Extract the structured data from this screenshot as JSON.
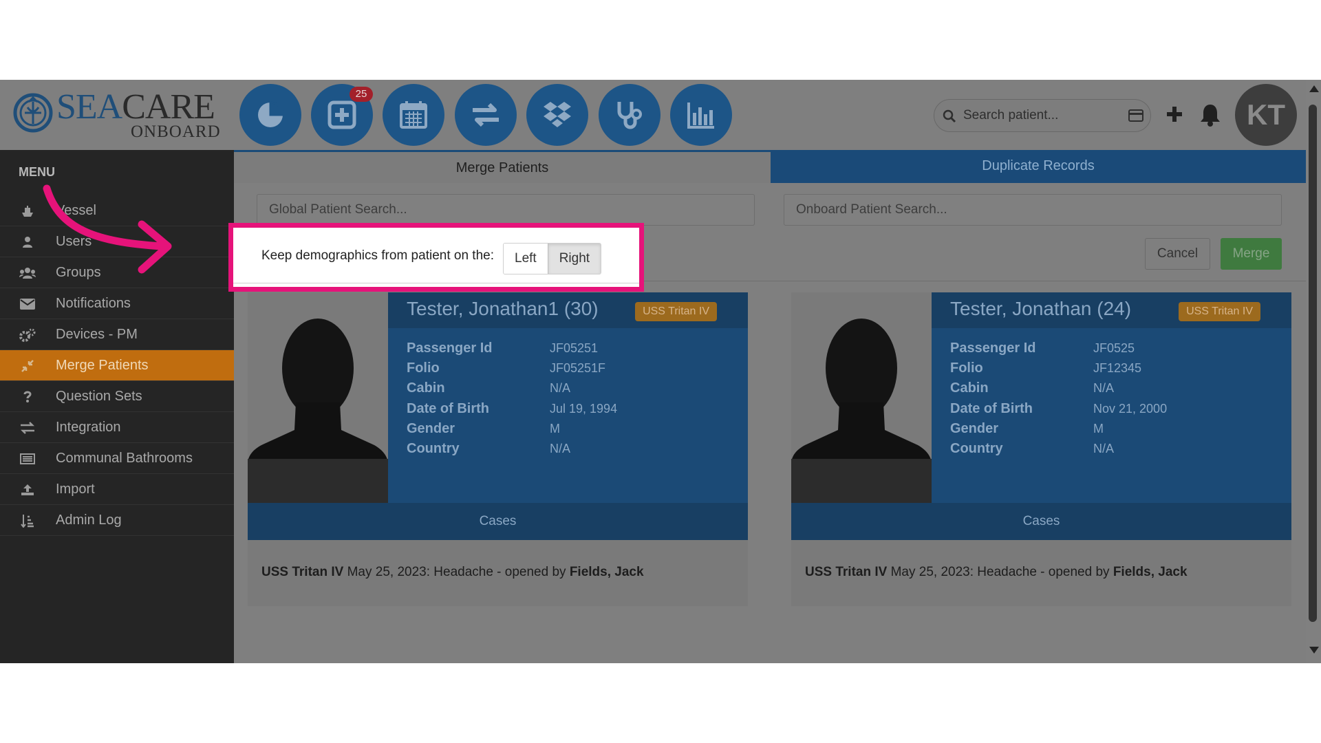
{
  "logo": {
    "word_sea": "SEA",
    "word_care": "CARE",
    "sub": "ONBOARD"
  },
  "nav": [
    {
      "name": "dashboard",
      "icon": "pie-chart-icon"
    },
    {
      "name": "new-case",
      "icon": "plus-square-icon",
      "badge": "25"
    },
    {
      "name": "calendar",
      "icon": "calendar-icon"
    },
    {
      "name": "transfers",
      "icon": "exchange-icon"
    },
    {
      "name": "dropbox",
      "icon": "dropbox-icon"
    },
    {
      "name": "medical",
      "icon": "stethoscope-icon"
    },
    {
      "name": "reports",
      "icon": "bar-chart-icon"
    }
  ],
  "search": {
    "placeholder": "Search patient..."
  },
  "user": {
    "initials": "KT"
  },
  "menu": {
    "title": "MENU",
    "items": [
      {
        "label": "Vessel",
        "icon": "ship-icon"
      },
      {
        "label": "Users",
        "icon": "user-icon"
      },
      {
        "label": "Groups",
        "icon": "users-icon"
      },
      {
        "label": "Notifications",
        "icon": "envelope-icon"
      },
      {
        "label": "Devices - PM",
        "icon": "cogs-icon"
      },
      {
        "label": "Merge Patients",
        "icon": "compress-icon",
        "active": true
      },
      {
        "label": "Question Sets",
        "icon": "question-icon"
      },
      {
        "label": "Integration",
        "icon": "exchange-icon"
      },
      {
        "label": "Communal Bathrooms",
        "icon": "list-alt-icon"
      },
      {
        "label": "Import",
        "icon": "upload-icon"
      },
      {
        "label": "Admin Log",
        "icon": "sort-amount-icon"
      }
    ]
  },
  "tabs": {
    "merge": "Merge Patients",
    "duplicates": "Duplicate Records"
  },
  "fields": {
    "global_placeholder": "Global Patient Search...",
    "onboard_placeholder": "Onboard Patient Search..."
  },
  "actions": {
    "cancel": "Cancel",
    "merge": "Merge"
  },
  "keep": {
    "label": "Keep demographics from patient on the:",
    "left": "Left",
    "right": "Right",
    "selected": "Right"
  },
  "patients": [
    {
      "name": "Tester, Jonathan1 (30)",
      "ship": "USS Tritan IV",
      "fields": [
        {
          "k": "Passenger Id",
          "v": "JF05251"
        },
        {
          "k": "Folio",
          "v": "JF05251F"
        },
        {
          "k": "Cabin",
          "v": "N/A"
        },
        {
          "k": "Date of Birth",
          "v": "Jul 19, 1994"
        },
        {
          "k": "Gender",
          "v": "M"
        },
        {
          "k": "Country",
          "v": "N/A"
        }
      ],
      "cases_label": "Cases",
      "case": {
        "ship": "USS Tritan IV",
        "text": "May 25, 2023: Headache - opened by",
        "by": "Fields, Jack"
      }
    },
    {
      "name": "Tester, Jonathan (24)",
      "ship": "USS Tritan IV",
      "fields": [
        {
          "k": "Passenger Id",
          "v": "JF0525"
        },
        {
          "k": "Folio",
          "v": "JF12345"
        },
        {
          "k": "Cabin",
          "v": "N/A"
        },
        {
          "k": "Date of Birth",
          "v": "Nov 21, 2000"
        },
        {
          "k": "Gender",
          "v": "M"
        },
        {
          "k": "Country",
          "v": "N/A"
        }
      ],
      "cases_label": "Cases",
      "case": {
        "ship": "USS Tritan IV",
        "text": "May 25, 2023: Headache - opened by",
        "by": "Fields, Jack"
      }
    }
  ],
  "colors": {
    "brand_blue": "#1d5587",
    "active_menu": "#c06d0f",
    "highlight": "#e6137a",
    "merge_green": "#3f7a3f"
  }
}
